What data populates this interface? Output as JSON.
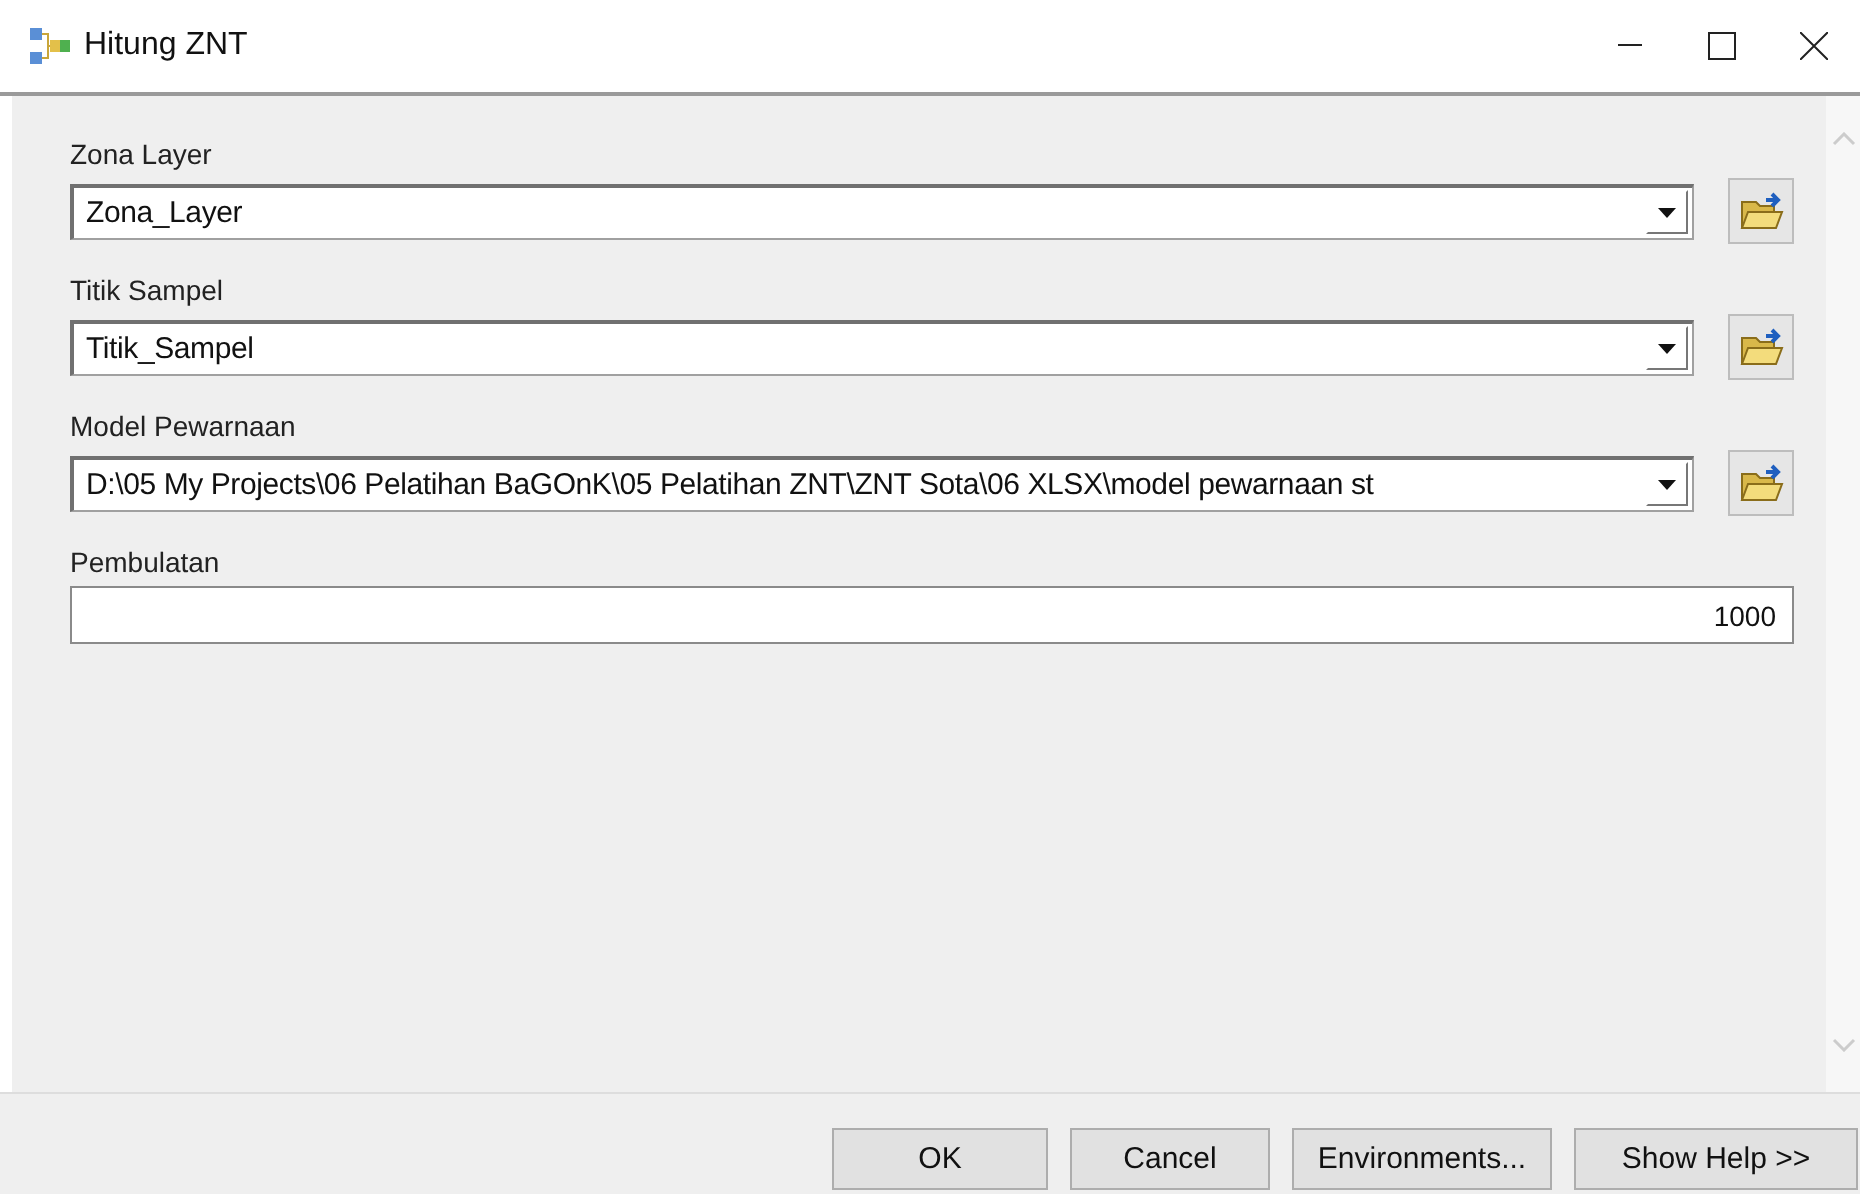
{
  "window": {
    "title": "Hitung ZNT"
  },
  "parameters": [
    {
      "kind": "combo",
      "label": "Zona Layer",
      "value": "Zona_Layer"
    },
    {
      "kind": "combo",
      "label": "Titik Sampel",
      "value": "Titik_Sampel"
    },
    {
      "kind": "combo",
      "label": "Model Pewarnaan",
      "value": "D:\\05 My Projects\\06 Pelatihan BaGOnK\\05 Pelatihan ZNT\\ZNT Sota\\06 XLSX\\model pewarnaan st"
    },
    {
      "kind": "number",
      "label": "Pembulatan",
      "value": "1000"
    }
  ],
  "buttons": [
    "OK",
    "Cancel",
    "Environments...",
    "Show Help >>"
  ]
}
